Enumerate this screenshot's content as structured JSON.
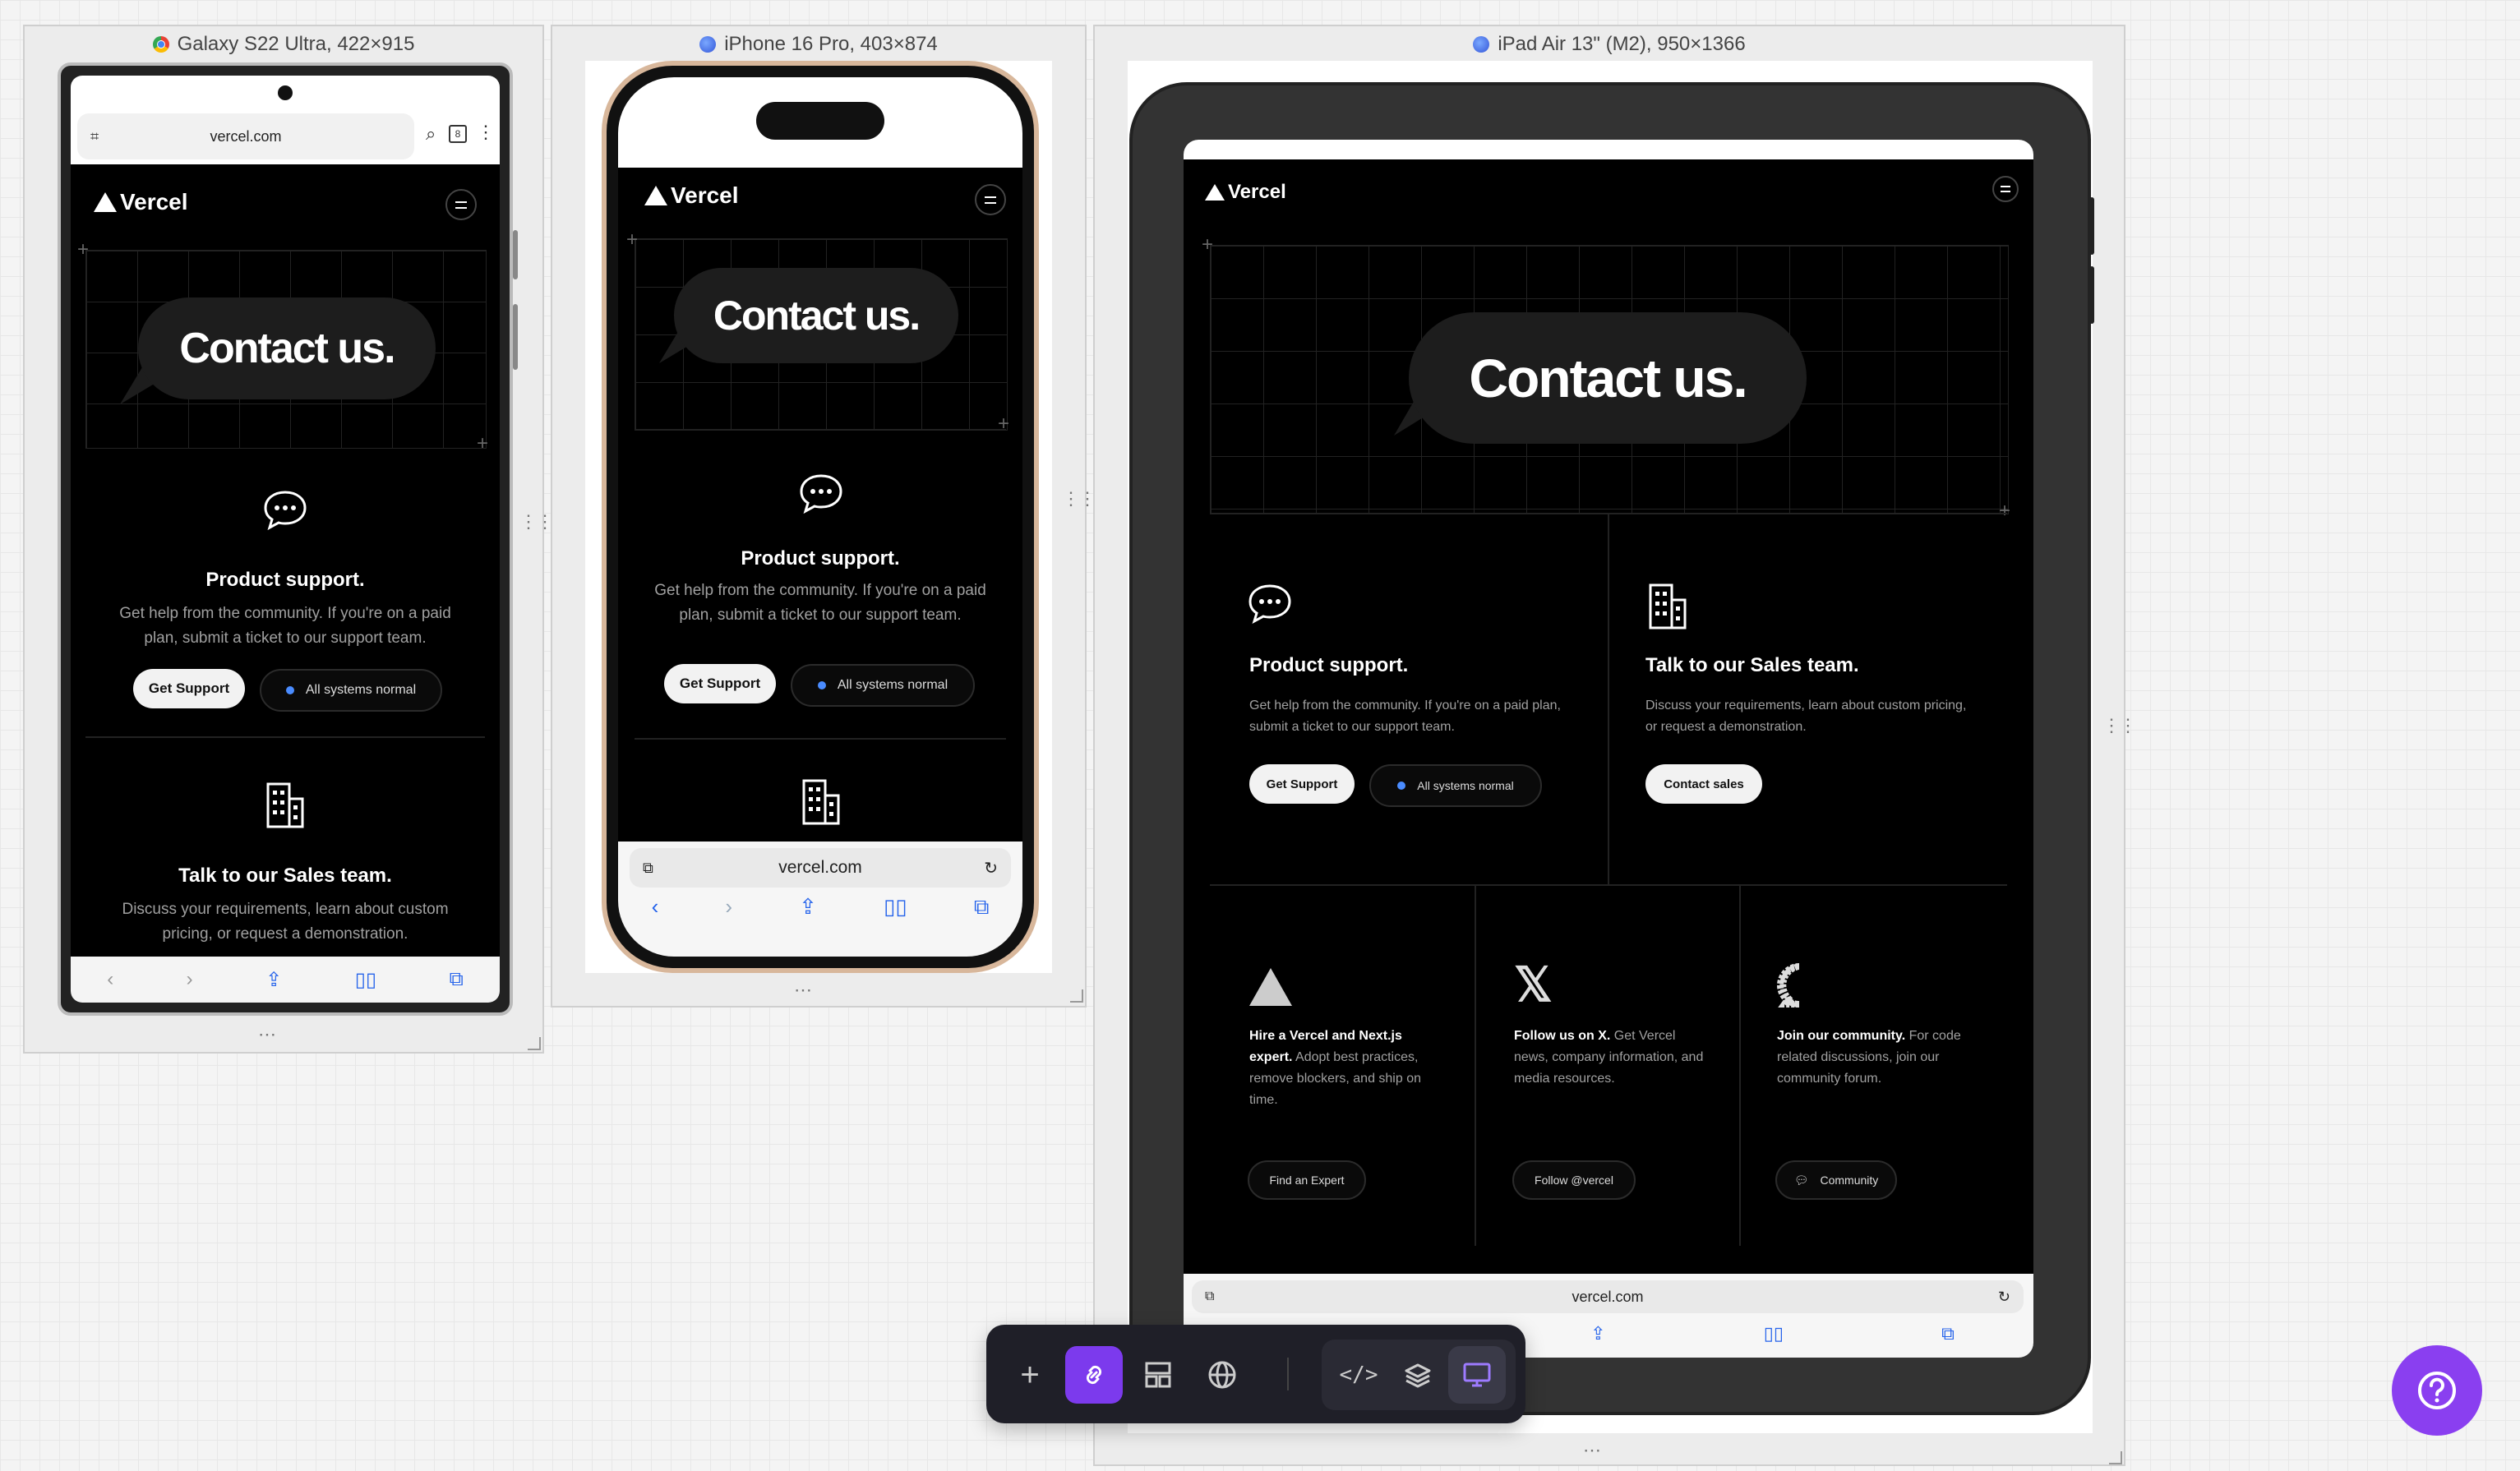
{
  "devices": {
    "galaxy": {
      "title": "Galaxy S22 Ultra, 422×915",
      "url": "vercel.com"
    },
    "iphone": {
      "title": "iPhone 16 Pro, 403×874",
      "url": "vercel.com"
    },
    "ipad": {
      "title": "iPad Air 13\" (M2), 950×1366",
      "url": "vercel.com"
    }
  },
  "site": {
    "logo": "Vercel",
    "hero": "Contact us.",
    "support": {
      "title": "Product support.",
      "desc": "Get help from the community. If you're on a paid plan, submit a ticket to our support team.",
      "button": "Get Support",
      "status": "All systems normal"
    },
    "sales": {
      "title": "Talk to our Sales team.",
      "desc": "Discuss your requirements, learn about custom pricing, or request a demonstration.",
      "button": "Contact sales"
    },
    "expert": {
      "bold": "Hire a Vercel and Next.js expert.",
      "desc": " Adopt best practices, remove blockers, and ship on time.",
      "button": "Find an Expert"
    },
    "x": {
      "bold": "Follow us on X.",
      "desc": " Get Vercel news, company information, and media resources.",
      "button": "Follow @vercel"
    },
    "community": {
      "bold": "Join our community.",
      "desc": " For code related discussions, join our community forum.",
      "button": "Community"
    }
  },
  "colors": {
    "accent": "#8a3ff0",
    "link_active": "#7c3aed",
    "toolbar_bg": "#1f1f28",
    "status_dot": "#4a8cff"
  }
}
